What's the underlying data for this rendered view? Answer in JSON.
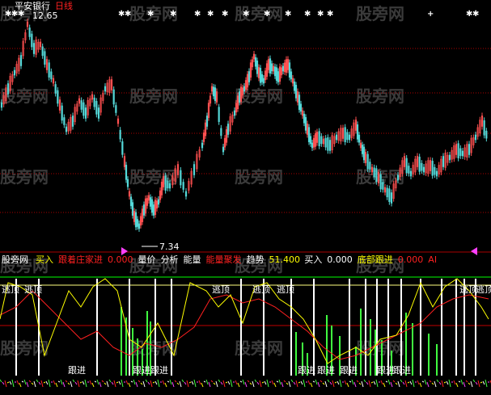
{
  "top_panel": {
    "stock_name": "平安银行",
    "period": "日线",
    "high_label": "12.65",
    "low_label": "7.34"
  },
  "indicator_header": {
    "panel_name": "股旁网",
    "items": [
      {
        "label": "买入",
        "color": "#ffff00"
      },
      {
        "label": "跟着庄家进",
        "color": "#ff2020"
      },
      {
        "label": "0.000",
        "color": "#ff2020"
      },
      {
        "label": "量价",
        "color": "#ffffff"
      },
      {
        "label": "分析",
        "color": "#ffffff"
      },
      {
        "label": "能量",
        "color": "#ffffff"
      },
      {
        "label": "能量聚发",
        "color": "#ff2020"
      },
      {
        "label": "趋势",
        "color": "#ffffff"
      },
      {
        "label": "51.400",
        "color": "#ffff00"
      },
      {
        "label": "买入",
        "color": "#ffffff"
      },
      {
        "label": "0.000",
        "color": "#ffffff"
      },
      {
        "label": "底部跟进",
        "color": "#ffff00"
      },
      {
        "label": "0.000",
        "color": "#ff2020"
      },
      {
        "label": "AI",
        "color": "#ff2020"
      }
    ]
  },
  "signals": {
    "escape": "逃顶",
    "follow": "跟进"
  },
  "watermark": "股旁网",
  "colors": {
    "up": "#ff5050",
    "down": "#54d8d8",
    "grid": "#aa0000",
    "yellow_line": "#ffff00",
    "red_line": "#ff2020",
    "green_bar": "#40ff40",
    "white_bar": "#ffffff"
  }
}
